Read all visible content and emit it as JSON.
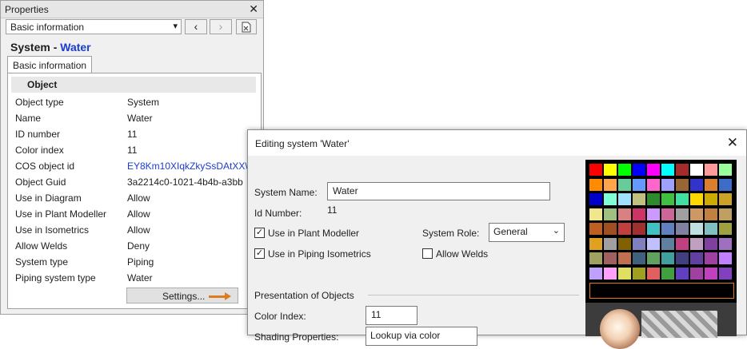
{
  "properties_panel": {
    "title": "Properties",
    "close_glyph": "✕",
    "category_select": {
      "value": "Basic information"
    },
    "system_label": "System -",
    "system_name": "Water",
    "tab_label": "Basic information",
    "group_header": "Object",
    "rows": [
      {
        "key": "Object type",
        "value": "System"
      },
      {
        "key": "Name",
        "value": "Water"
      },
      {
        "key": "ID number",
        "value": "11"
      },
      {
        "key": "Color index",
        "value": "11"
      },
      {
        "key": "COS object id",
        "value": "EY8Km10XIqkZkySsDAtXX\\"
      },
      {
        "key": "Object Guid",
        "value": "3a2214c0-1021-4b4b-a3bb"
      },
      {
        "key": "Use in Diagram",
        "value": "Allow"
      },
      {
        "key": "Use in Plant Modeller",
        "value": "Allow"
      },
      {
        "key": "Use in Isometrics",
        "value": "Allow"
      },
      {
        "key": "Allow Welds",
        "value": "Deny"
      },
      {
        "key": "System type",
        "value": "Piping"
      },
      {
        "key": "Piping system type",
        "value": "Water"
      }
    ],
    "settings_button": "Settings...",
    "icons": [
      "chevron-down-icon",
      "back-arrow-icon",
      "forward-arrow-icon",
      "excel-export-icon",
      "orange-arrow-icon"
    ]
  },
  "edit_dialog": {
    "title": "Editing system 'Water'",
    "close_glyph": "✕",
    "system_name_label": "System Name:",
    "system_name_value": "Water",
    "id_number_label": "Id Number:",
    "id_number_value": "11",
    "use_in_plant_modeller": {
      "label": "Use in Plant Modeller",
      "checked": true
    },
    "use_in_piping_isometrics": {
      "label": "Use in Piping Isometrics",
      "checked": true
    },
    "allow_welds": {
      "label": "Allow Welds",
      "checked": false
    },
    "system_role_label": "System Role:",
    "system_role_value": "General",
    "presentation_header": "Presentation of Objects",
    "color_index_label": "Color Index:",
    "color_index_value": "11",
    "shading_label": "Shading Properties:",
    "shading_value": "Lookup via color",
    "palette_colors": [
      [
        "#ff0000",
        "#ffff00",
        "#00ff00",
        "#0000ff",
        "#ff00ff",
        "#00ffff",
        "#a52a2a",
        "#ffffff",
        "#ff9a9a",
        "#9aff9a"
      ],
      [
        "#ff8c00",
        "#ffa64d",
        "#66cc99",
        "#6699ff",
        "#ff66cc",
        "#a0a0ff",
        "#996633",
        "#3333cc",
        "#d97f2e",
        "#3c6dc8"
      ],
      [
        "#0000cc",
        "#80ffd4",
        "#a0e0ff",
        "#c0c080",
        "#2d8a2d",
        "#40c040",
        "#40e0a0",
        "#ffd700",
        "#ccaa00",
        "#c9a227"
      ],
      [
        "#f0e68c",
        "#a0c080",
        "#d98080",
        "#cc3366",
        "#cc99ff",
        "#cc6699",
        "#a0a0a0",
        "#cc9966",
        "#c08040",
        "#c0a060"
      ],
      [
        "#c06020",
        "#a05020",
        "#c04040",
        "#a03030",
        "#40c0c0",
        "#6080c0",
        "#8080a0",
        "#c0e0e0",
        "#80c0c0",
        "#a0a040"
      ],
      [
        "#e0a020",
        "#a0a0a0",
        "#806000",
        "#8080c0",
        "#c0c0ff",
        "#6080a0",
        "#c04080",
        "#c0a0c0",
        "#8040a0",
        "#a070c0"
      ],
      [
        "#a0a060",
        "#a06060",
        "#c07050",
        "#406080",
        "#60a060",
        "#40a0a0",
        "#404080",
        "#6040a0",
        "#a040a0",
        "#c080ff"
      ],
      [
        "#c0a0ff",
        "#ffa0ff",
        "#e0e060",
        "#a0a020",
        "#e06060",
        "#40a040",
        "#6040c0",
        "#a040a0",
        "#c040c0",
        "#8040c0"
      ],
      [
        "#00e000",
        "#20e0e0",
        "#ff40ff",
        "#c0c060",
        "#c0e0e0",
        "#4040c0",
        "#000000",
        "#000000",
        "#000000",
        "#000000"
      ],
      [
        "#e0e000",
        "#c0c080",
        "#ffffff",
        "#a0a0c0",
        "#e08040",
        "#000000",
        "#000000",
        "#000000",
        "#000000",
        "#000000"
      ]
    ]
  }
}
